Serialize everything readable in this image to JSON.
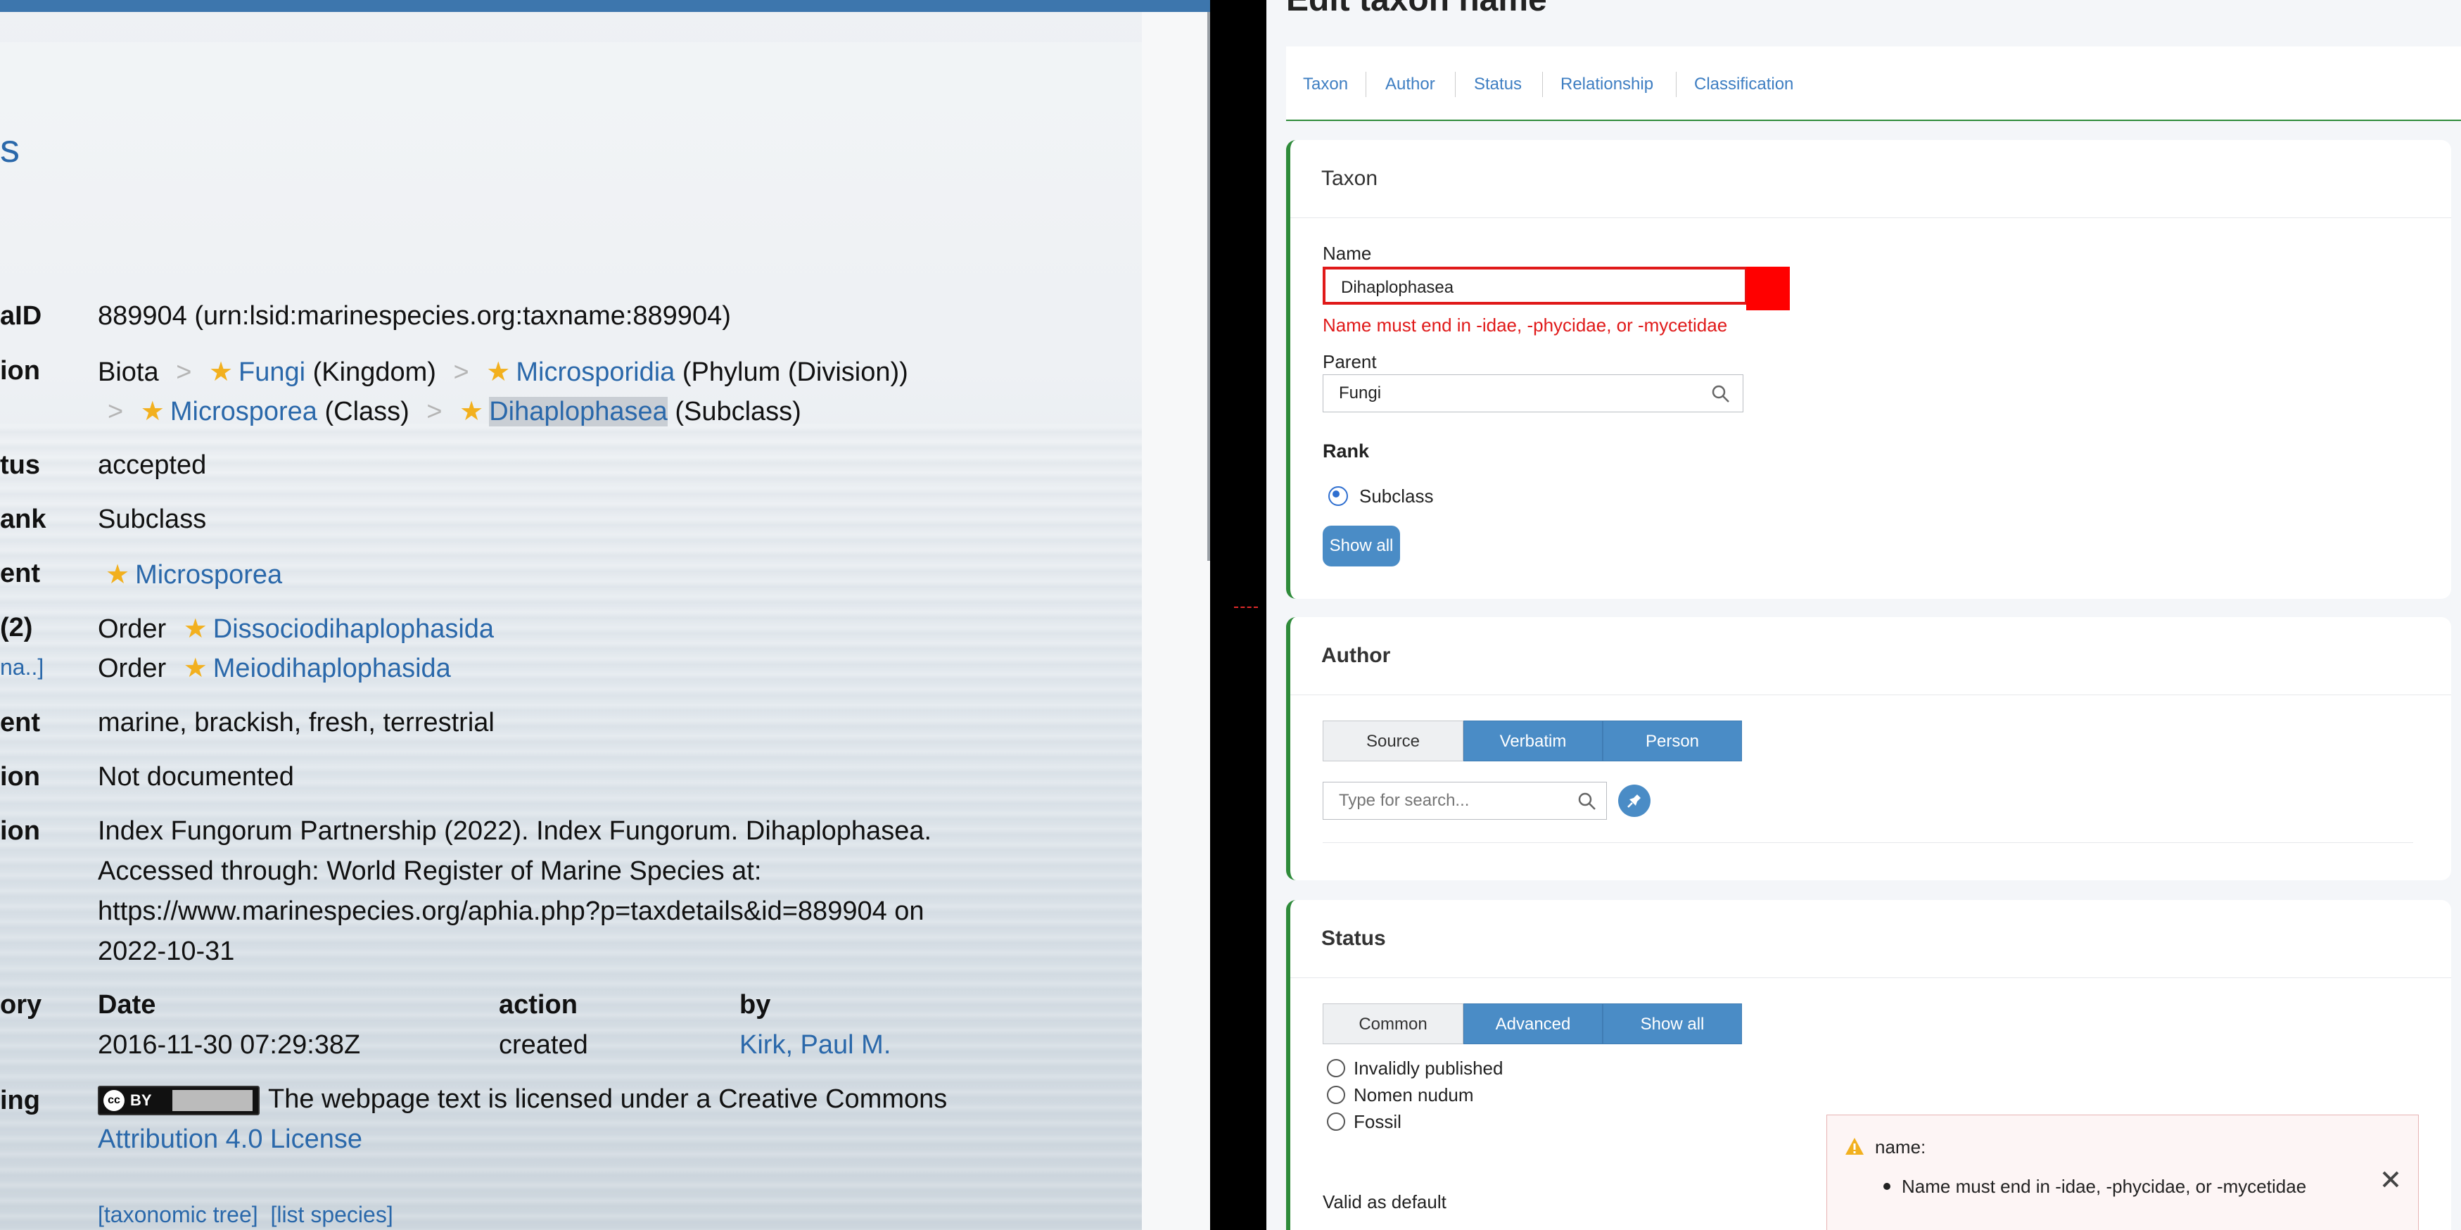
{
  "left": {
    "rows": [
      {
        "label": "aID",
        "value": "889904  (urn:lsid:marinespecies.org:taxname:889904)"
      },
      {
        "label": "ion"
      },
      {
        "label": "tus",
        "value": "accepted"
      },
      {
        "label": "ank",
        "value": "Subclass"
      },
      {
        "label": "ent"
      },
      {
        "label": "(2)"
      },
      {
        "label": "ent",
        "value": "marine, brackish, fresh, terrestrial"
      },
      {
        "label": "ion",
        "value": "Not documented"
      },
      {
        "label": "ion"
      },
      {
        "label": "ory"
      },
      {
        "label": "ing"
      }
    ],
    "heading_fragment": "s",
    "aphia_link_fragment": "na..]",
    "classification": {
      "root": "Biota",
      "items": [
        {
          "name": "Fungi",
          "rank": "(Kingdom)"
        },
        {
          "name": "Microsporidia",
          "rank": "(Phylum (Division))"
        },
        {
          "name": "Microsporea",
          "rank": "(Class)"
        },
        {
          "name": "Dihaplophasea",
          "rank": "(Subclass)"
        }
      ],
      "separator": ">"
    },
    "parent": "Microsporea",
    "children": [
      {
        "rank": "Order",
        "name": "Dissociodihaplophasida"
      },
      {
        "rank": "Order",
        "name": "Meiodihaplophasida"
      }
    ],
    "citation_lines": [
      "Index Fungorum Partnership (2022). Index Fungorum. Dihaplophasea.",
      "Accessed through: World Register of Marine Species at:",
      "https://www.marinespecies.org/aphia.php?p=taxdetails&id=889904 on",
      "2022-10-31"
    ],
    "history": {
      "headers": [
        "Date",
        "action",
        "by"
      ],
      "row": [
        "2016-11-30 07:29:38Z",
        "created",
        "Kirk, Paul M."
      ]
    },
    "license": {
      "badge_cc": "cc",
      "badge_by": "BY",
      "text": "The webpage text is licensed under a Creative Commons",
      "link": "Attribution 4.0 License"
    },
    "footer_links": [
      "[taxonomic tree]",
      "[list species]"
    ]
  },
  "right": {
    "title": "Edit taxon name",
    "tabs": [
      "Taxon",
      "Author",
      "Status",
      "Relationship",
      "Classification"
    ],
    "taxon": {
      "heading": "Taxon",
      "name_label": "Name",
      "name_value": "Dihaplophasea",
      "name_error": "Name must end in -idae, -phycidae, or -mycetidae",
      "parent_label": "Parent",
      "parent_value": "Fungi",
      "rank_label": "Rank",
      "rank_option": "Subclass",
      "show_all": "Show all"
    },
    "author": {
      "heading": "Author",
      "segments": [
        "Source",
        "Verbatim",
        "Person"
      ],
      "search_placeholder": "Type for search..."
    },
    "status": {
      "heading": "Status",
      "segments": [
        "Common",
        "Advanced",
        "Show all"
      ],
      "options": [
        "Invalidly published",
        "Nomen nudum",
        "Fossil"
      ],
      "valid_default": "Valid as default"
    },
    "toast": {
      "field": "name:",
      "message": "Name must end in -idae, -phycidae, or -mycetidae"
    }
  },
  "colors": {
    "link": "#2a68aa",
    "accent_blue": "#4a8cc6",
    "section_green": "#2e8b3a",
    "error_red": "#e01919",
    "star": "#f2b01e"
  }
}
